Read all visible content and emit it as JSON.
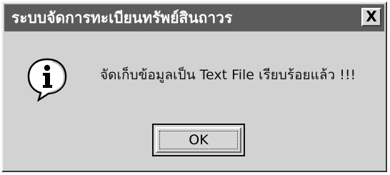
{
  "dialog": {
    "title": "ระบบจัดการทะเบียนทรัพย์สินถาวร",
    "close_label": "X",
    "icon": "information-icon",
    "message": "จัดเก็บข้อมูลเป็น Text File เรียบร้อยแล้ว !!!",
    "ok_label": "OK"
  }
}
